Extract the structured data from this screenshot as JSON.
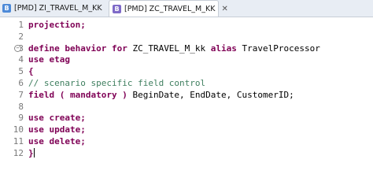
{
  "tabs": [
    {
      "label": "[PMD] ZI_TRAVEL_M_KK",
      "active": false
    },
    {
      "label": "[PMD] ZC_TRAVEL_M_KK",
      "active": true,
      "close": "✕"
    }
  ],
  "lines": [
    {
      "n": "1",
      "tokens": [
        {
          "t": "projection;",
          "c": "kw"
        }
      ]
    },
    {
      "n": "2",
      "tokens": []
    },
    {
      "n": "3",
      "fold": true,
      "tokens": [
        {
          "t": "define behavior for ",
          "c": "kw"
        },
        {
          "t": "ZC_TRAVEL_M_kk ",
          "c": ""
        },
        {
          "t": "alias ",
          "c": "kw"
        },
        {
          "t": "TravelProcessor",
          "c": ""
        }
      ]
    },
    {
      "n": "4",
      "tokens": [
        {
          "t": "use etag",
          "c": "kw"
        }
      ]
    },
    {
      "n": "5",
      "tokens": [
        {
          "t": "{",
          "c": "kw"
        }
      ]
    },
    {
      "n": "6",
      "tokens": [
        {
          "t": "// scenario specific field control",
          "c": "cm"
        }
      ]
    },
    {
      "n": "7",
      "tokens": [
        {
          "t": "field ( mandatory ) ",
          "c": "kw"
        },
        {
          "t": "BeginDate, EndDate, CustomerID;",
          "c": ""
        }
      ]
    },
    {
      "n": "8",
      "tokens": []
    },
    {
      "n": "9",
      "tokens": [
        {
          "t": "use create;",
          "c": "kw"
        }
      ]
    },
    {
      "n": "10",
      "tokens": [
        {
          "t": "use update;",
          "c": "kw"
        }
      ]
    },
    {
      "n": "11",
      "tokens": [
        {
          "t": "use delete;",
          "c": "kw"
        }
      ]
    },
    {
      "n": "12",
      "caret": true,
      "tokens": [
        {
          "t": "}",
          "c": "kw"
        }
      ]
    }
  ]
}
